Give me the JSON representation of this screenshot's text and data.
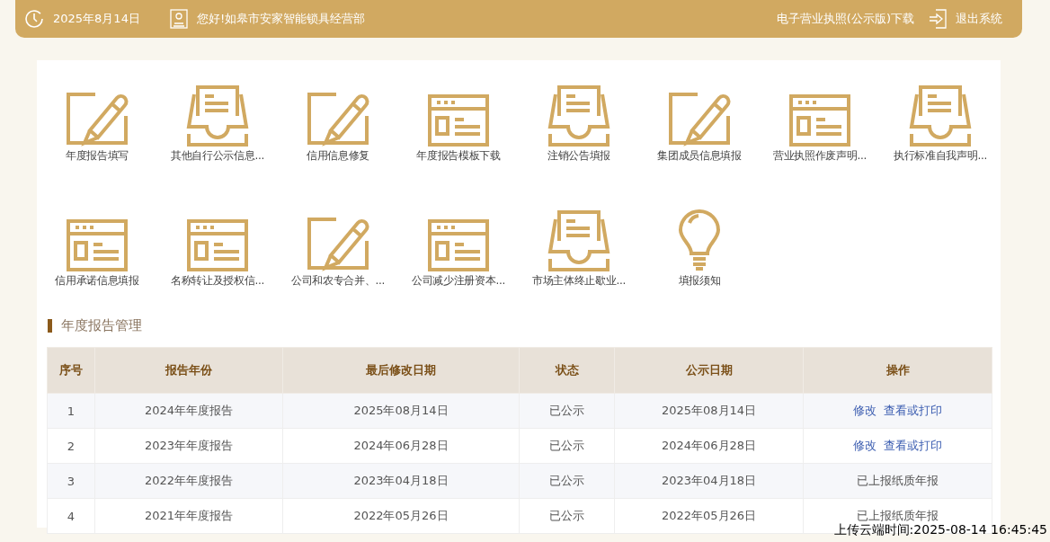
{
  "header": {
    "date": "2025年8月14日",
    "greeting": "您好!如皋市安家智能锁具经营部",
    "license_link": "电子营业执照(公示版)下载",
    "logout": "退出系统"
  },
  "tiles": [
    {
      "label": "年度报告填写",
      "kind": "pencil"
    },
    {
      "label": "其他自行公示信息...",
      "kind": "inbox"
    },
    {
      "label": "信用信息修复",
      "kind": "pencil"
    },
    {
      "label": "年度报告模板下载",
      "kind": "window"
    },
    {
      "label": "注销公告填报",
      "kind": "inbox"
    },
    {
      "label": "集团成员信息填报",
      "kind": "pencil"
    },
    {
      "label": "营业执照作废声明...",
      "kind": "window"
    },
    {
      "label": "执行标准自我声明...",
      "kind": "inbox"
    },
    {
      "label": "信用承诺信息填报",
      "kind": "window"
    },
    {
      "label": "名称转让及授权信...",
      "kind": "window"
    },
    {
      "label": "公司和农专合并、...",
      "kind": "pencil"
    },
    {
      "label": "公司减少注册资本...",
      "kind": "window"
    },
    {
      "label": "市场主体终止歇业...",
      "kind": "inbox"
    },
    {
      "label": "填报须知",
      "kind": "bulb"
    }
  ],
  "section_title": "年度报告管理",
  "table": {
    "columns": [
      "序号",
      "报告年份",
      "最后修改日期",
      "状态",
      "公示日期",
      "操作"
    ],
    "rows": [
      {
        "cells": [
          "1",
          "2024年年度报告",
          "2025年08月14日",
          "已公示",
          "2025年08月14日"
        ],
        "ops": {
          "kind": "links",
          "items": [
            "修改",
            "查看或打印"
          ]
        }
      },
      {
        "cells": [
          "2",
          "2023年年度报告",
          "2024年06月28日",
          "已公示",
          "2024年06月28日"
        ],
        "ops": {
          "kind": "links",
          "items": [
            "修改",
            "查看或打印"
          ]
        }
      },
      {
        "cells": [
          "3",
          "2022年年度报告",
          "2023年04月18日",
          "已公示",
          "2023年04月18日"
        ],
        "ops": {
          "kind": "text",
          "items": [
            "已上报纸质年报"
          ]
        }
      },
      {
        "cells": [
          "4",
          "2021年年度报告",
          "2022年05月26日",
          "已公示",
          "2022年05月26日"
        ],
        "ops": {
          "kind": "text",
          "items": [
            "已上报纸质年报"
          ]
        }
      }
    ]
  },
  "upload_stamp": "上传云端时间:2025-08-14 16:45:45"
}
